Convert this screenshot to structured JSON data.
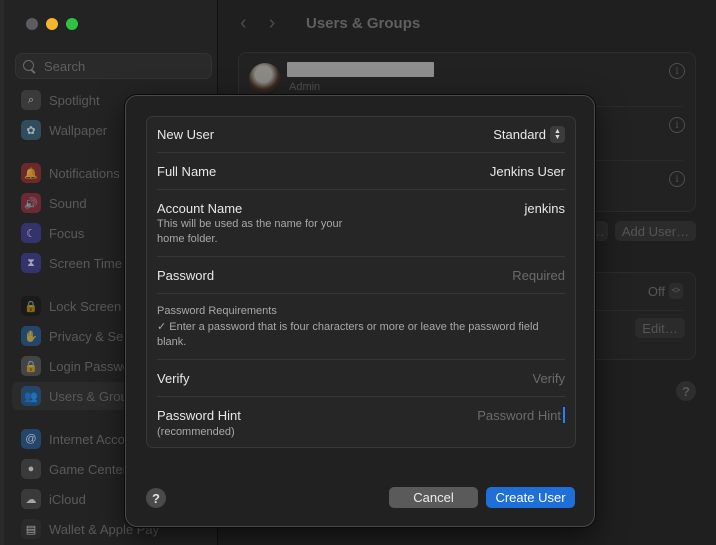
{
  "window": {
    "title": "Users & Groups",
    "traffic_lights": {
      "close": "#5b5d60",
      "minimize": "#f5b52f",
      "maximize": "#2fc146"
    }
  },
  "sidebar": {
    "search_placeholder": "Search",
    "items": [
      {
        "label": "Spotlight",
        "icon": "magnifier-icon",
        "color": "#3a3a3a",
        "glyph": "⌕"
      },
      {
        "label": "Wallpaper",
        "icon": "flower-icon",
        "color": "#2f4d5c",
        "glyph": "✿"
      },
      {
        "label": "Notifications",
        "icon": "bell-icon",
        "color": "#6b2a2a",
        "glyph": "🔔"
      },
      {
        "label": "Sound",
        "icon": "speaker-icon",
        "color": "#6b2a33",
        "glyph": "🔊"
      },
      {
        "label": "Focus",
        "icon": "moon-icon",
        "color": "#35336b",
        "glyph": "☾"
      },
      {
        "label": "Screen Time",
        "icon": "hourglass-icon",
        "color": "#35336b",
        "glyph": "⧗"
      },
      {
        "label": "Lock Screen",
        "icon": "lock-icon",
        "color": "#1a1a1a",
        "glyph": "🔒"
      },
      {
        "label": "Privacy & Security",
        "icon": "hand-icon",
        "color": "#25466b",
        "glyph": "✋"
      },
      {
        "label": "Login Password",
        "icon": "lock-icon",
        "color": "#444444",
        "glyph": "🔒"
      },
      {
        "label": "Users & Groups",
        "icon": "users-icon",
        "color": "#25466b",
        "glyph": "👥",
        "active": true
      },
      {
        "label": "Internet Accounts",
        "icon": "at-icon",
        "color": "#25466b",
        "glyph": "@"
      },
      {
        "label": "Game Center",
        "icon": "game-center-icon",
        "color": "#3a3a3a",
        "glyph": "●"
      },
      {
        "label": "iCloud",
        "icon": "cloud-icon",
        "color": "#3a3a3a",
        "glyph": "☁"
      },
      {
        "label": "Wallet & Apple Pay",
        "icon": "wallet-icon",
        "color": "#2a2a2a",
        "glyph": "▤"
      }
    ]
  },
  "main": {
    "title": "Users & Groups",
    "back_arrow": "‹",
    "forward_arrow": "›",
    "users": [
      {
        "role": "Admin"
      }
    ],
    "add_user_label": "Add User…",
    "auto_login_value": "Off",
    "edit_label": "Edit…",
    "help_label": "?"
  },
  "modal": {
    "new_user": {
      "label": "New User",
      "value": "Standard"
    },
    "full_name": {
      "label": "Full Name",
      "value": "Jenkins User"
    },
    "account_name": {
      "label": "Account Name",
      "sub": "This will be used as the name for your home folder.",
      "value": "jenkins"
    },
    "password": {
      "label": "Password",
      "placeholder": "Required"
    },
    "password_requirements": {
      "title": "Password Requirements",
      "text": "✓  Enter a password that is four characters or more or leave the password field blank."
    },
    "verify": {
      "label": "Verify",
      "placeholder": "Verify"
    },
    "password_hint": {
      "label": "Password Hint",
      "sub": "(recommended)",
      "placeholder": "Password Hint"
    },
    "help_label": "?",
    "cancel_label": "Cancel",
    "create_label": "Create User",
    "accent_color": "#1f6fd8"
  }
}
